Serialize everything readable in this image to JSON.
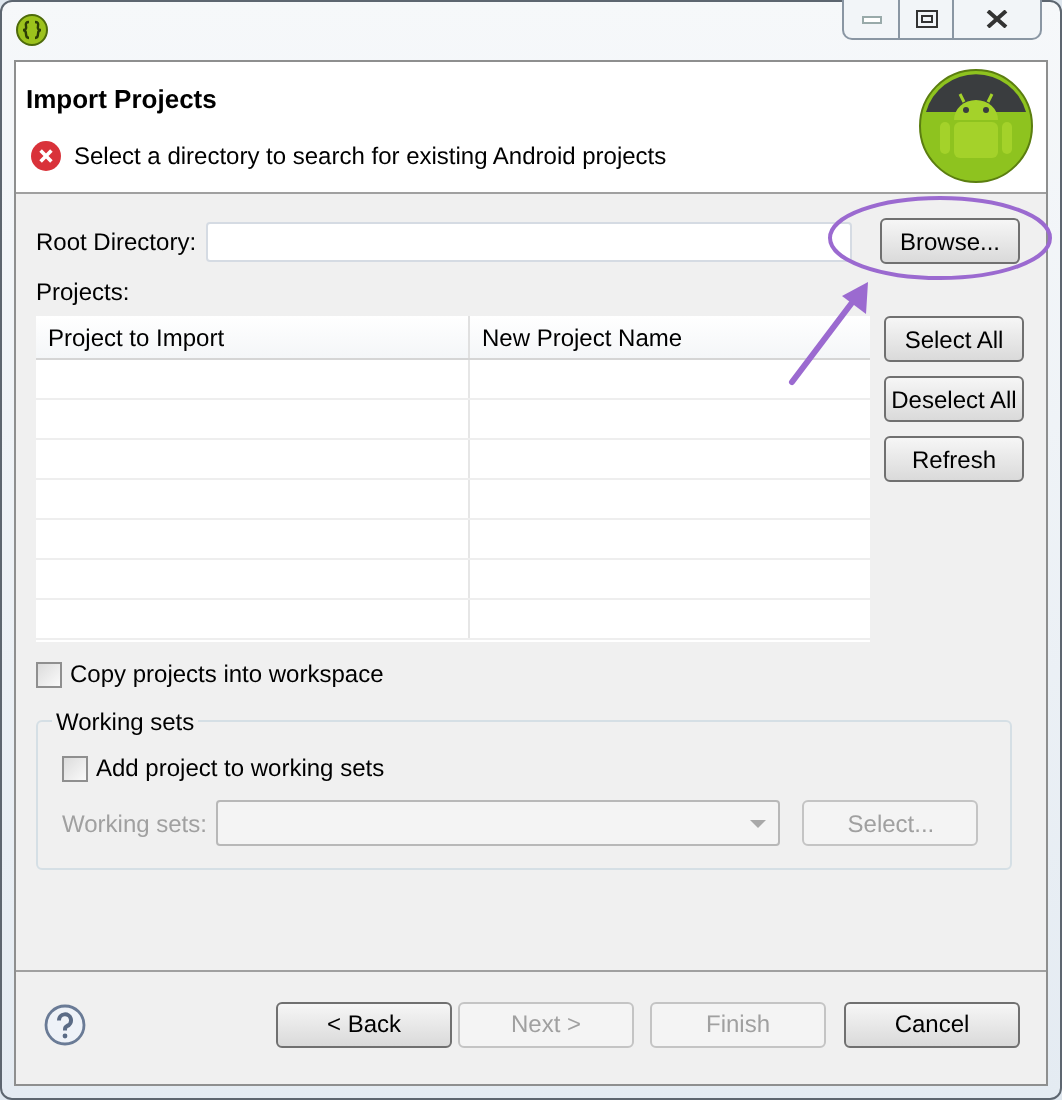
{
  "header": {
    "title": "Import Projects",
    "message": {
      "kind": "error",
      "text": "Select a directory to search for existing Android projects"
    }
  },
  "root_directory": {
    "label": "Root Directory:",
    "button": {
      "label": "Browse...",
      "disabled": false
    }
  },
  "projects": {
    "label": "Projects:",
    "columns": [
      "Project to Import",
      "New Project Name"
    ],
    "buttons": [
      {
        "label": "Select All",
        "disabled": false
      },
      {
        "label": "Deselect All",
        "disabled": false
      },
      {
        "label": "Refresh",
        "disabled": false
      }
    ]
  },
  "copy_into_workspace": {
    "label": "Copy projects into workspace",
    "checked": false
  },
  "working_sets": {
    "title": "Working sets",
    "checkbox": {
      "label": "Add project to working sets",
      "checked": false
    },
    "field_label": "Working sets:",
    "disabled": true,
    "button": {
      "label": "Select...",
      "disabled": true
    }
  },
  "footer": {
    "buttons": [
      {
        "label": "< Back",
        "disabled": false
      },
      {
        "label": "Next >",
        "disabled": true
      },
      {
        "label": "Finish",
        "disabled": true
      },
      {
        "label": "Cancel",
        "disabled": false
      }
    ]
  }
}
